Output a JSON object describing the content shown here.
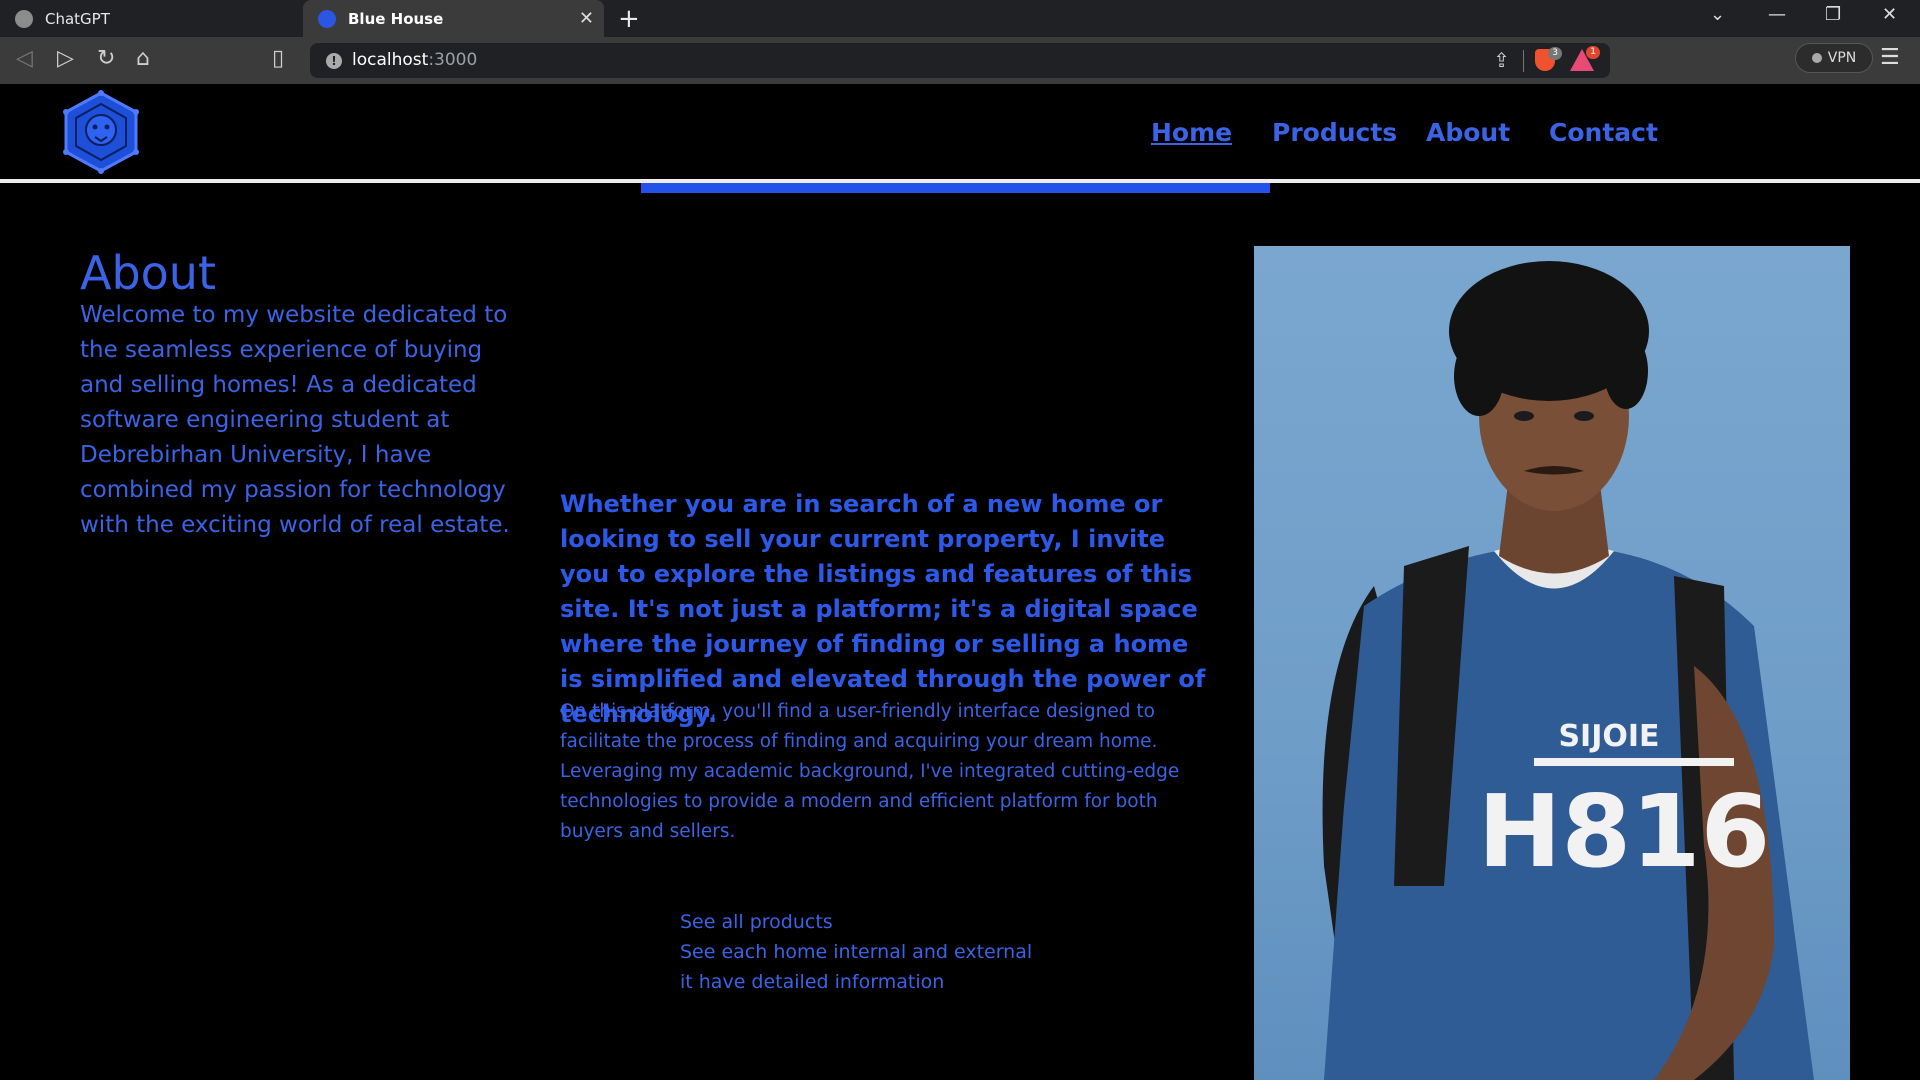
{
  "browser": {
    "tabs": [
      {
        "title": "ChatGPT",
        "active": false
      },
      {
        "title": "Blue House",
        "active": true
      }
    ],
    "url_host": "localhost",
    "url_port": ":3000",
    "vpn_label": "VPN",
    "shield_count": "3",
    "rewards_count": "1"
  },
  "site": {
    "nav": [
      {
        "label": "Home",
        "active": true
      },
      {
        "label": "Products",
        "active": false
      },
      {
        "label": "About",
        "active": false
      },
      {
        "label": "Contact",
        "active": false
      }
    ],
    "about_title": "About",
    "about_text": "Welcome to my website dedicated to the seamless experience of buying and selling homes! As a dedicated software engineering student at Debrebirhan University, I have combined my passion for technology with the exciting world of real estate.",
    "lead_text": "Whether you are in search of a new home or looking to sell your current property, I invite you to explore the listings and features of this site. It's not just a platform; it's a digital space where the journey of finding or selling a home is simplified and elevated through the power of technology.",
    "body_text": "On this platform, you'll find a user-friendly interface designed to facilitate the process of finding and acquiring your dream home. Leveraging my academic background, I've integrated cutting-edge technologies to provide a modern and efficient platform for both buyers and sellers.",
    "links": [
      "See all products",
      "See each home internal and external",
      "it have detailed information"
    ],
    "photo": {
      "shirt_text_top": "SIJOIE",
      "shirt_text_main": "H816"
    }
  },
  "colors": {
    "accent": "#3b63e6",
    "background": "#000000"
  }
}
